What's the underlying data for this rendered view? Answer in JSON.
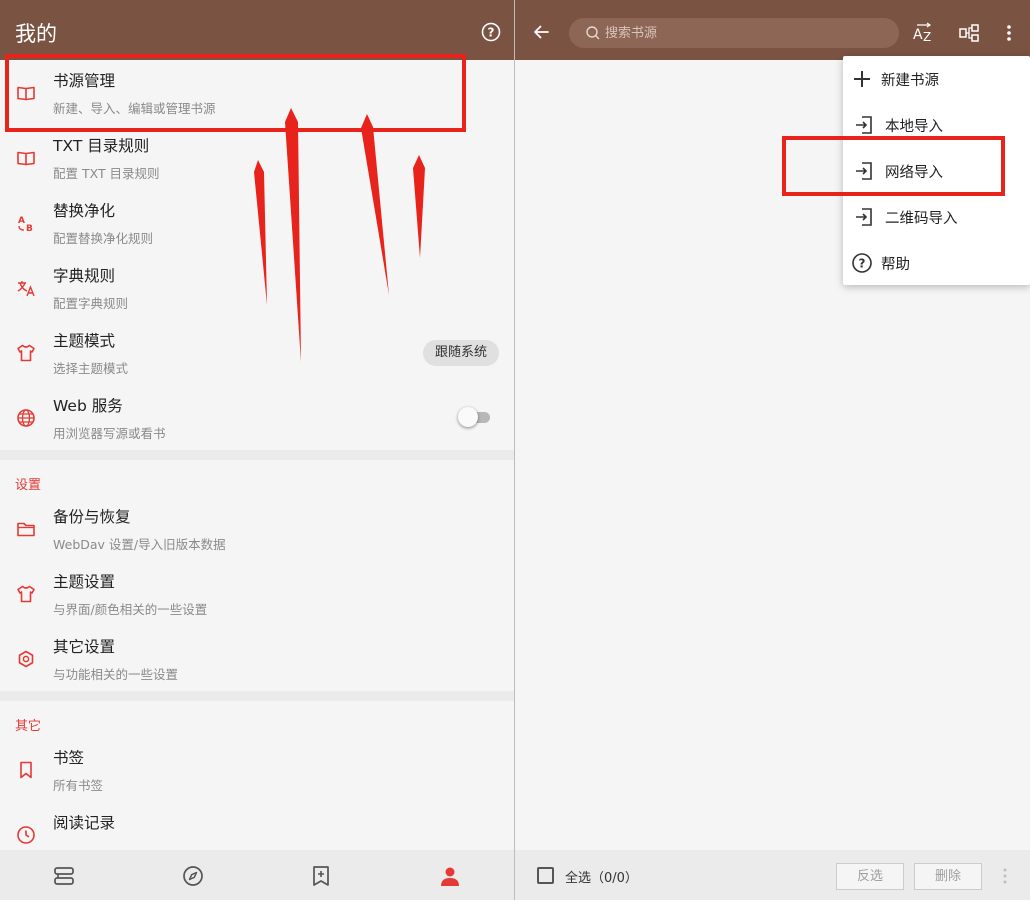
{
  "left": {
    "appbar": {
      "title": "我的"
    },
    "items_group1": [
      {
        "title": "书源管理",
        "subtitle": "新建、导入、编辑或管理书源",
        "icon": "book-open-icon"
      },
      {
        "title": "TXT 目录规则",
        "subtitle": "配置 TXT 目录规则",
        "icon": "book-open-icon"
      },
      {
        "title": "替换净化",
        "subtitle": "配置替换净化规则",
        "icon": "replace-ab-icon"
      },
      {
        "title": "字典规则",
        "subtitle": "配置字典规则",
        "icon": "translate-icon"
      },
      {
        "title": "主题模式",
        "subtitle": "选择主题模式",
        "icon": "shirt-icon",
        "chip": "跟随系统"
      },
      {
        "title": "Web 服务",
        "subtitle": "用浏览器写源或看书",
        "icon": "globe-icon",
        "switch_on": false
      }
    ],
    "section_settings": "设置",
    "items_group2": [
      {
        "title": "备份与恢复",
        "subtitle": "WebDav 设置/导入旧版本数据",
        "icon": "folder-icon"
      },
      {
        "title": "主题设置",
        "subtitle": "与界面/颜色相关的一些设置",
        "icon": "shirt-icon"
      },
      {
        "title": "其它设置",
        "subtitle": "与功能相关的一些设置",
        "icon": "hexagon-settings-icon"
      }
    ],
    "section_other": "其它",
    "items_group3": [
      {
        "title": "书签",
        "subtitle": "所有书签",
        "icon": "bookmark-icon"
      },
      {
        "title": "阅读记录",
        "subtitle": "",
        "icon": "clock-icon"
      }
    ],
    "bottom_nav": [
      "bookshelf-icon",
      "compass-icon",
      "bookmark-plus-icon",
      "person-icon"
    ]
  },
  "right": {
    "search": {
      "placeholder": "搜索书源"
    },
    "toolbar_icons": [
      "back-arrow-icon",
      "sort-az-icon",
      "group-icon",
      "more-vert-icon"
    ],
    "popup_menu": [
      {
        "label": "新建书源",
        "icon": "plus-icon"
      },
      {
        "label": "本地导入",
        "icon": "import-icon"
      },
      {
        "label": "网络导入",
        "icon": "import-icon"
      },
      {
        "label": "二维码导入",
        "icon": "import-icon"
      },
      {
        "label": "帮助",
        "icon": "help-circle-icon"
      }
    ],
    "bottom": {
      "select_all": "全选（0/0）",
      "invert": "反选",
      "delete": "删除"
    }
  },
  "colors": {
    "appbar": "#7b5343",
    "accent_red": "#e53935",
    "annotation_red": "#e8231c"
  }
}
